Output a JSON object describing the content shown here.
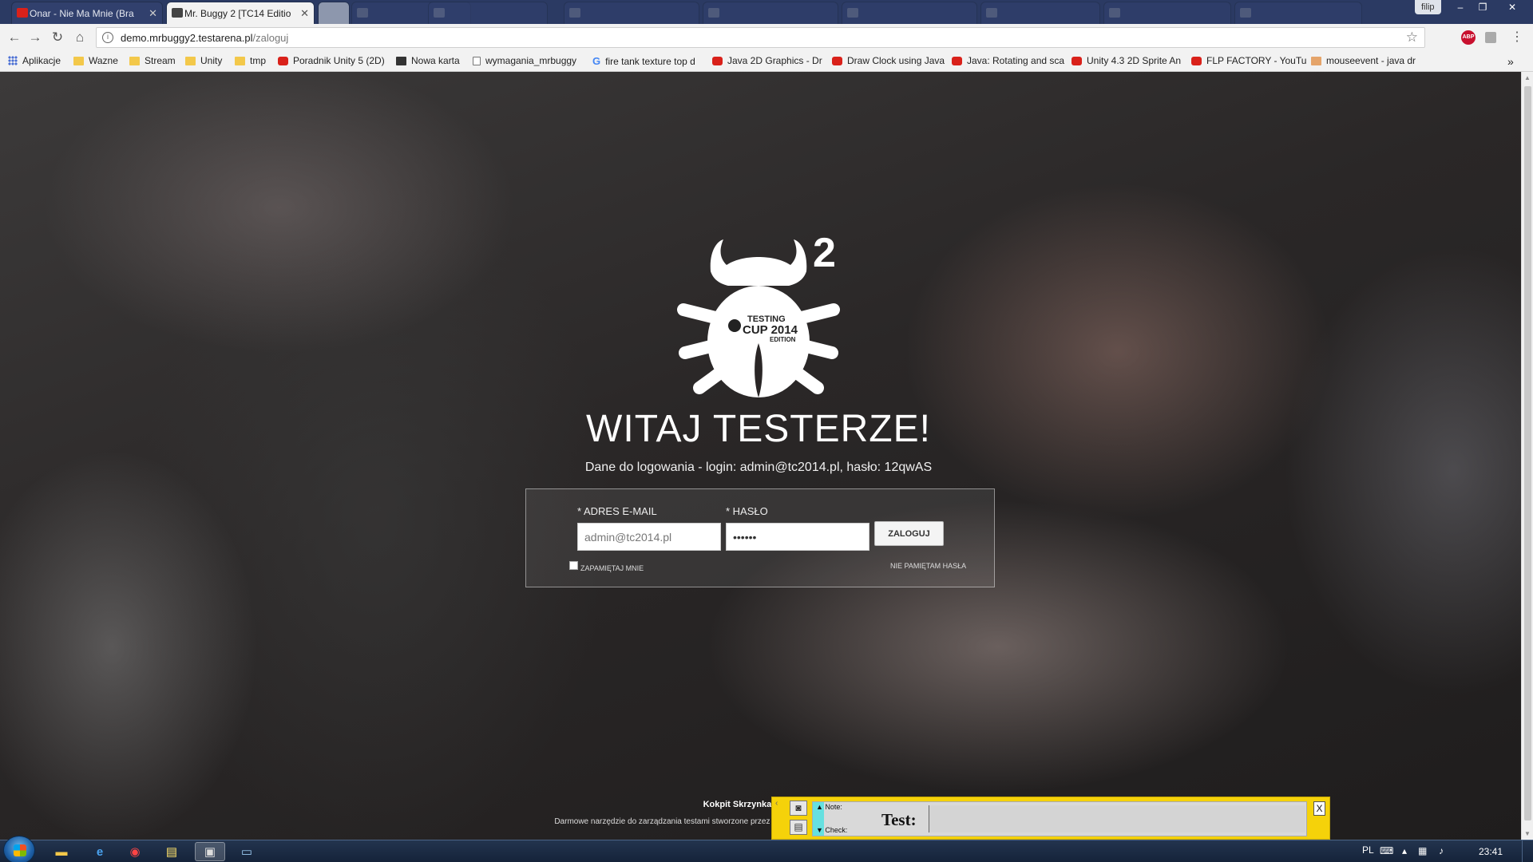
{
  "browser": {
    "tabs": [
      {
        "title": "Onar - Nie Ma Mnie (Bra",
        "active": false
      },
      {
        "title": "Mr. Buggy 2 [TC14 Editio",
        "active": true
      },
      {
        "title": "",
        "active": false
      }
    ],
    "user_chip": "filip",
    "url_host": "demo.mrbuggy2.testarena.pl",
    "url_path": "/zaloguj",
    "bookmarks": [
      {
        "label": "Aplikacje",
        "icon": "apps-grid-icon"
      },
      {
        "label": "Wazne",
        "icon": "folder-icon"
      },
      {
        "label": "Stream",
        "icon": "folder-icon"
      },
      {
        "label": "Unity",
        "icon": "folder-icon"
      },
      {
        "label": "tmp",
        "icon": "folder-icon"
      },
      {
        "label": "Poradnik Unity 5 (2D)",
        "icon": "youtube-icon"
      },
      {
        "label": "Nowa karta",
        "icon": "star-icon"
      },
      {
        "label": "wymagania_mrbuggy",
        "icon": "document-icon"
      },
      {
        "label": "fire tank texture top d",
        "icon": "google-icon"
      },
      {
        "label": "Java 2D Graphics - Dr",
        "icon": "youtube-icon"
      },
      {
        "label": "Draw Clock using Java",
        "icon": "youtube-icon"
      },
      {
        "label": "Java: Rotating and sca",
        "icon": "youtube-icon"
      },
      {
        "label": "Unity 4.3 2D Sprite An",
        "icon": "youtube-icon"
      },
      {
        "label": "FLP FACTORY - YouTu",
        "icon": "youtube-icon"
      },
      {
        "label": "mouseevent - java dr",
        "icon": "java-icon"
      }
    ],
    "overflow_label": "»"
  },
  "page": {
    "logo_superscript": "2",
    "logo_text_1": "TESTING",
    "logo_text_2": "CUP 2014",
    "logo_text_3": "EDITION",
    "welcome": "WITAJ TESTERZE!",
    "login_info": "Dane do logowania - login: admin@tc2014.pl, hasło: 12qwAS",
    "form": {
      "email_label": "* ADRES E-MAIL",
      "email_value": "admin@tc2014.pl",
      "password_label": "* HASŁO",
      "password_value": "••••••",
      "submit_label": "ZALOGUJ",
      "remember_label": "ZAPAMIĘTAJ MNIE",
      "forgot_label": "NIE PAMIĘTAM HASŁA"
    },
    "footer_links": "Kokpit Skrzynka pocztowa",
    "footer_copy": "Darmowe narzędzie do zarządzania testami stworzone przez 21CN. Wszelkie prawa zastrzeżone. (version 1.1.656)"
  },
  "note_widget": {
    "note_label": "▲ Note:",
    "check_label": "▼ Check:",
    "test_label": "Test:",
    "close_label": "X"
  },
  "taskbar": {
    "language": "PL",
    "clock": "23:41"
  }
}
